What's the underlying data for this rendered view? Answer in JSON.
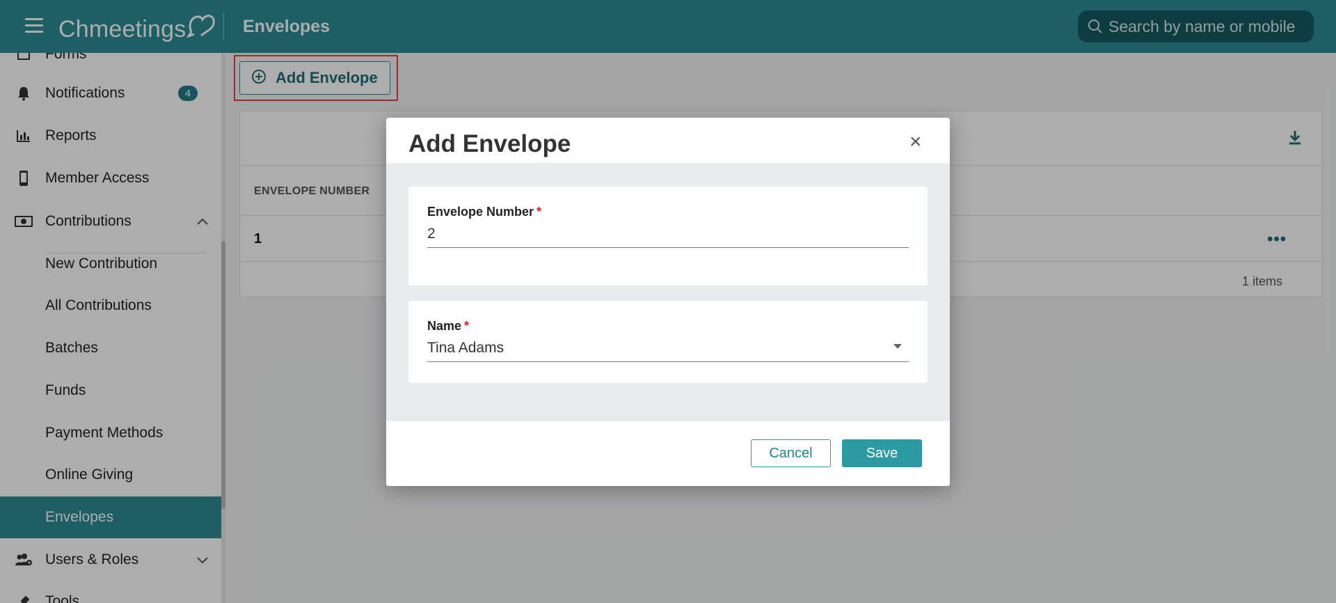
{
  "header": {
    "logo_text": "Chmeetings",
    "page_title": "Envelopes",
    "search_placeholder": "Search by name or mobile"
  },
  "sidebar": {
    "items": [
      {
        "label": "Forms",
        "icon": "forms-icon"
      },
      {
        "label": "Notifications",
        "icon": "bell-icon",
        "badge": "4"
      },
      {
        "label": "Reports",
        "icon": "bar-chart-icon"
      },
      {
        "label": "Member Access",
        "icon": "mobile-icon"
      },
      {
        "label": "Contributions",
        "icon": "money-icon"
      },
      {
        "label": "New Contribution"
      },
      {
        "label": "All Contributions"
      },
      {
        "label": "Batches"
      },
      {
        "label": "Funds"
      },
      {
        "label": "Payment Methods"
      },
      {
        "label": "Online Giving"
      },
      {
        "label": "Envelopes",
        "active": true
      },
      {
        "label": "Users & Roles",
        "icon": "users-cog-icon"
      },
      {
        "label": "Tools",
        "icon": "tools-icon"
      }
    ]
  },
  "main": {
    "add_button_label": "Add Envelope",
    "table": {
      "columns": [
        "ENVELOPE NUMBER"
      ],
      "rows": [
        [
          "1"
        ]
      ],
      "footer_count": "1 items"
    }
  },
  "modal": {
    "title": "Add Envelope",
    "close_glyph": "×",
    "fields": [
      {
        "label": "Envelope Number",
        "required_mark": "*",
        "value": "2"
      },
      {
        "label": "Name",
        "required_mark": "*",
        "value": "Tina Adams"
      }
    ],
    "cancel_label": "Cancel",
    "save_label": "Save"
  },
  "colors": {
    "brand": "#2b8d96",
    "highlight_outline": "#e0453b"
  }
}
